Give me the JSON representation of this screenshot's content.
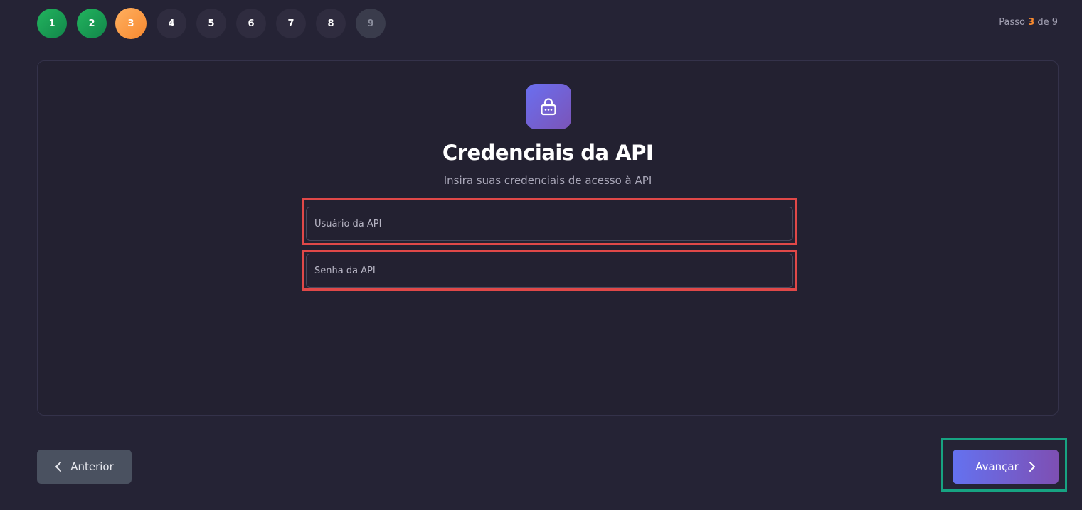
{
  "stepper": {
    "steps": [
      {
        "label": "1",
        "state": "done"
      },
      {
        "label": "2",
        "state": "done"
      },
      {
        "label": "3",
        "state": "current"
      },
      {
        "label": "4",
        "state": "pending"
      },
      {
        "label": "5",
        "state": "pending"
      },
      {
        "label": "6",
        "state": "pending"
      },
      {
        "label": "7",
        "state": "pending"
      },
      {
        "label": "8",
        "state": "pending"
      },
      {
        "label": "9",
        "state": "pending"
      }
    ],
    "counter_prefix": "Passo",
    "counter_current": "3",
    "counter_sep": "de",
    "counter_total": "9"
  },
  "card": {
    "icon": "lock-icon",
    "title": "Credenciais da API",
    "subtitle": "Insira suas credenciais de acesso à API",
    "user_field": {
      "placeholder": "Usuário da API",
      "value": ""
    },
    "password_field": {
      "placeholder": "Senha da API",
      "value": ""
    }
  },
  "nav": {
    "prev_label": "Anterior",
    "next_label": "Avançar"
  },
  "colors": {
    "background": "#252335",
    "done": "#1a9f55",
    "current": "#f7892f",
    "accent_start": "#6472f0",
    "accent_end": "#7e4fb3",
    "highlight_red": "#e04848",
    "highlight_teal": "#17a382"
  }
}
